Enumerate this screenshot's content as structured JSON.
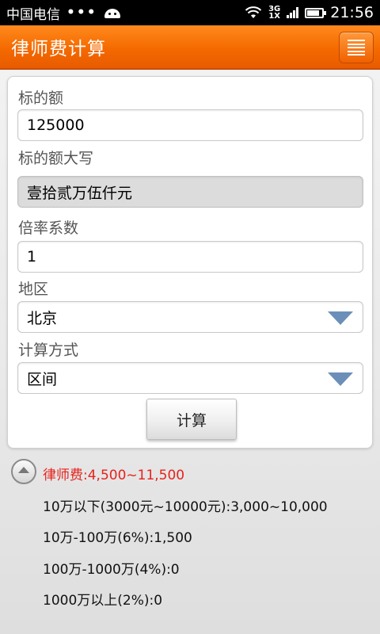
{
  "status_bar": {
    "carrier": "中国电信",
    "dots": "•••",
    "network_top": "3G",
    "network_bottom": "1X",
    "time": "21:56",
    "icons": [
      "android-icon",
      "wifi-icon",
      "signal-icon",
      "battery-icon"
    ]
  },
  "header": {
    "title": "律师费计算",
    "menu_icon": "menu-icon"
  },
  "colors": {
    "header_orange": "#f46a00",
    "result_red": "#e8211b",
    "dropdown_blue": "#6b8fb8"
  },
  "form": {
    "amount_label": "标的额",
    "amount_value": "125000",
    "amount_upper_label": "标的额大写",
    "amount_upper_value": "壹拾贰万伍仟元",
    "rate_label": "倍率系数",
    "rate_value": "1",
    "region_label": "地区",
    "region_value": "北京",
    "method_label": "计算方式",
    "method_value": "区间",
    "calc_button": "计算"
  },
  "results": {
    "total": "律师费:4,500~11,500",
    "lines": [
      "10万以下(3000元~10000元):3,000~10,000",
      "10万-100万(6%):1,500",
      "100万-1000万(4%):0",
      "1000万以上(2%):0"
    ]
  }
}
